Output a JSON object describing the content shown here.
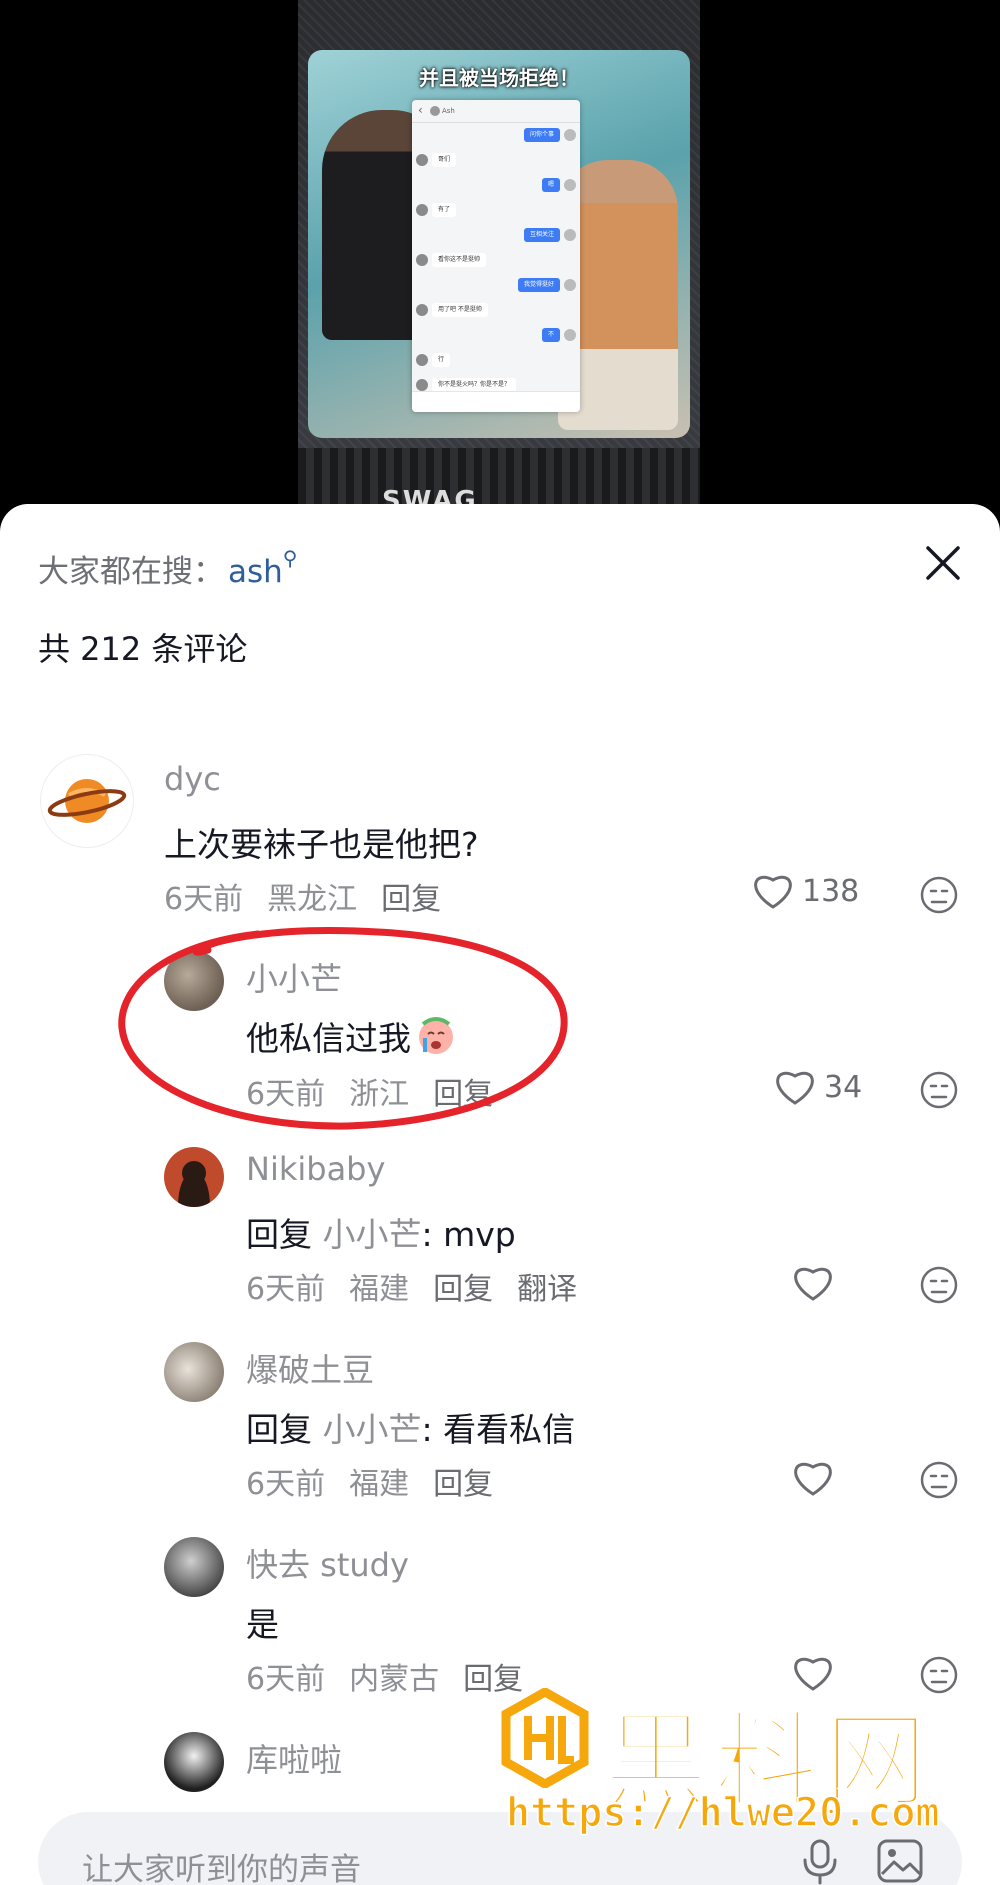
{
  "video": {
    "caption": "并且被当场拒绝！",
    "chat_left_messages": [
      "哥们",
      "有了",
      "看你这不是挺帅",
      "用了吧 不是挺帅",
      "行",
      "你不是挺火吗？你是不是？"
    ],
    "chat_right_messages": [
      "问你个事",
      "嗯",
      "互相关注",
      "我觉得挺好",
      "不"
    ],
    "bottom_text": "SWAG"
  },
  "panel": {
    "search_tip_prefix": "大家都在搜：",
    "search_tip_keyword": "ash",
    "comment_count": "共 212 条评论"
  },
  "comments": [
    {
      "user": "dyc",
      "text": "上次要袜子也是他把?",
      "time": "6天前",
      "location": "黑龙江",
      "reply_label": "回复",
      "likes": "138"
    },
    {
      "user": "小小芒",
      "text": "他私信过我",
      "time": "6天前",
      "location": "浙江",
      "reply_label": "回复",
      "likes": "34"
    },
    {
      "user": "Nikibaby",
      "reply_prefix": "回复",
      "reply_to": "小小芒",
      "text": ": mvp",
      "time": "6天前",
      "location": "福建",
      "reply_label": "回复",
      "translate_label": "翻译",
      "likes": ""
    },
    {
      "user": "爆破土豆",
      "reply_prefix": "回复",
      "reply_to": "小小芒",
      "text": ": 看看私信",
      "time": "6天前",
      "location": "福建",
      "reply_label": "回复",
      "likes": ""
    },
    {
      "user": "快去 study",
      "text": "是",
      "time": "6天前",
      "location": "内蒙古",
      "reply_label": "回复",
      "likes": ""
    },
    {
      "user": "库啦啦"
    }
  ],
  "input": {
    "placeholder": "让大家听到你的声音"
  },
  "watermark": {
    "title": "黑料网",
    "url": "https://hlwe20.com"
  },
  "colors": {
    "accent_link": "#2f5e99",
    "secondary_text": "#8f9096",
    "annotation_red": "#e4242a",
    "watermark_orange": "#f6a70c"
  }
}
